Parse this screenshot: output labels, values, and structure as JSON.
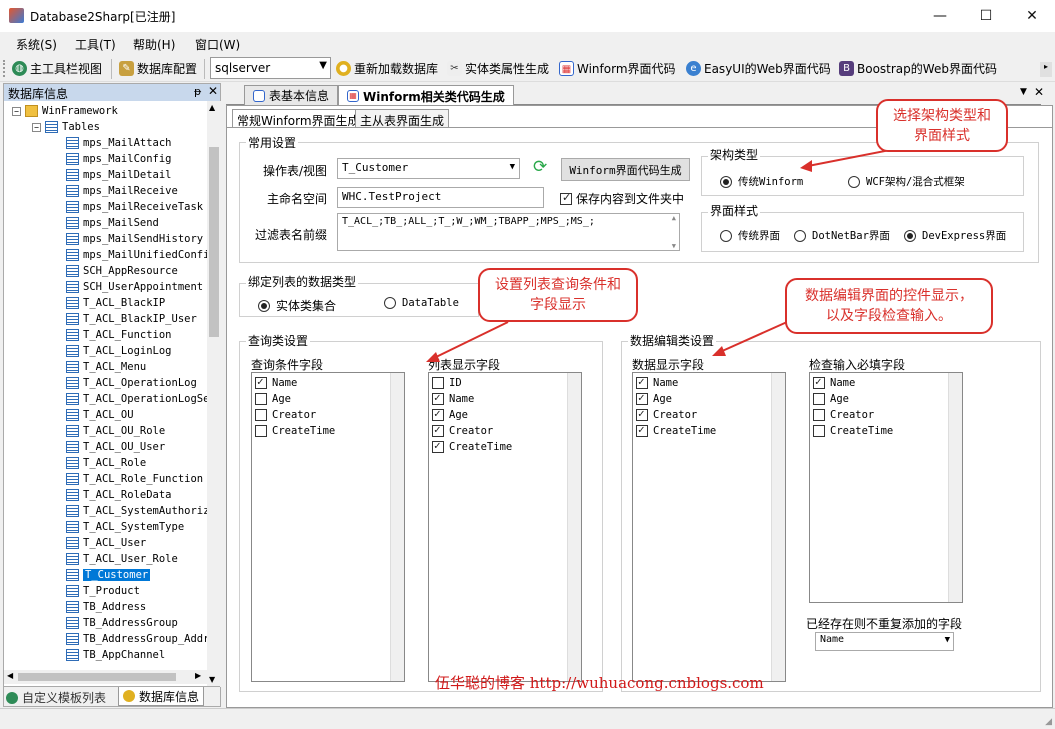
{
  "window": {
    "title": "Database2Sharp[已注册]"
  },
  "menu": [
    "系统(S)",
    "工具(T)",
    "帮助(H)",
    "窗口(W)"
  ],
  "toolbar": {
    "main_toolbar": "主工具栏视图",
    "db_config": "数据库配置",
    "db_type": "sqlserver",
    "reload": "重新加载数据库",
    "entity": "实体类属性生成",
    "winform": "Winform界面代码",
    "easyui": "EasyUI的Web界面代码",
    "bootstrap": "Boostrap的Web界面代码"
  },
  "left_panel": {
    "title": "数据库信息",
    "pin": "ᵽ",
    "root": "WinFramework",
    "tables_node": "Tables",
    "tables": [
      "mps_MailAttach",
      "mps_MailConfig",
      "mps_MailDetail",
      "mps_MailReceive",
      "mps_MailReceiveTask",
      "mps_MailSend",
      "mps_MailSendHistory",
      "mps_MailUnifiedConfi",
      "SCH_AppResource",
      "SCH_UserAppointment",
      "T_ACL_BlackIP",
      "T_ACL_BlackIP_User",
      "T_ACL_Function",
      "T_ACL_LoginLog",
      "T_ACL_Menu",
      "T_ACL_OperationLog",
      "T_ACL_OperationLogSe",
      "T_ACL_OU",
      "T_ACL_OU_Role",
      "T_ACL_OU_User",
      "T_ACL_Role",
      "T_ACL_Role_Function",
      "T_ACL_RoleData",
      "T_ACL_SystemAuthoriz",
      "T_ACL_SystemType",
      "T_ACL_User",
      "T_ACL_User_Role",
      "T_Customer",
      "T_Product",
      "TB_Address",
      "TB_AddressGroup",
      "TB_AddressGroup_Addr",
      "TB_AppChannel"
    ],
    "selected": "T_Customer",
    "bottom_tabs": [
      "自定义模板列表",
      "数据库信息"
    ]
  },
  "doc_tabs": [
    "表基本信息",
    "Winform相关类代码生成"
  ],
  "sub_tabs": [
    "常规Winform界面生成",
    "主从表界面生成"
  ],
  "common": {
    "title": "常用设置",
    "table_label": "操作表/视图",
    "table_value": "T_Customer",
    "gen_button": "Winform界面代码生成",
    "ns_label": "主命名空间",
    "ns_value": "WHC.TestProject",
    "save_label": "保存内容到文件夹中",
    "prefix_label": "过滤表名前缀",
    "prefix_value": "T_ACL_;TB_;ALL_;T_;W_;WM_;TBAPP_;MPS_;MS_;"
  },
  "arch": {
    "title": "架构类型",
    "options": [
      "传统Winform",
      "WCF架构/混合式框架"
    ]
  },
  "style": {
    "title": "界面样式",
    "options": [
      "传统界面",
      "DotNetBar界面",
      "DevExpress界面"
    ]
  },
  "bind": {
    "title": "绑定列表的数据类型",
    "options": [
      "实体类集合",
      "DataTable"
    ]
  },
  "query": {
    "title": "查询类设置",
    "cond_title": "查询条件字段",
    "cond_items": [
      {
        "t": "Name",
        "c": true
      },
      {
        "t": "Age",
        "c": false
      },
      {
        "t": "Creator",
        "c": false
      },
      {
        "t": "CreateTime",
        "c": false
      }
    ],
    "list_title": "列表显示字段",
    "list_items": [
      {
        "t": "ID",
        "c": false
      },
      {
        "t": "Name",
        "c": true
      },
      {
        "t": "Age",
        "c": true
      },
      {
        "t": "Creator",
        "c": true
      },
      {
        "t": "CreateTime",
        "c": true
      }
    ]
  },
  "edit": {
    "title": "数据编辑类设置",
    "show_title": "数据显示字段",
    "show_items": [
      {
        "t": "Name",
        "c": true
      },
      {
        "t": "Age",
        "c": true
      },
      {
        "t": "Creator",
        "c": true
      },
      {
        "t": "CreateTime",
        "c": true
      }
    ],
    "check_title": "检查输入必填字段",
    "check_items": [
      {
        "t": "Name",
        "c": true
      },
      {
        "t": "Age",
        "c": false
      },
      {
        "t": "Creator",
        "c": false
      },
      {
        "t": "CreateTime",
        "c": false
      }
    ],
    "exist_label": "已经存在则不重复添加的字段",
    "exist_value": "Name"
  },
  "callouts": {
    "c1": "选择架构类型和界面样式",
    "c2": "设置列表查询条件和字段显示",
    "c3": "数据编辑界面的控件显示，以及字段检查输入。"
  },
  "watermark": "伍华聪的博客 http://wuhuacong.cnblogs.com",
  "colors": {
    "callout": "#d9302b",
    "selection": "#0078d7",
    "panel_head": "#c8d8ec"
  }
}
